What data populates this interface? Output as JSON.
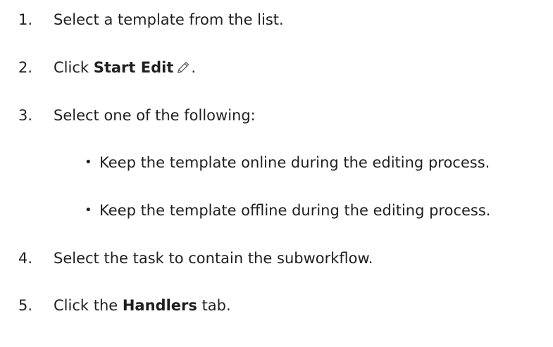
{
  "steps": [
    {
      "number": "1.",
      "text": "Select a template from the list."
    },
    {
      "number": "2.",
      "prefix": "Click ",
      "bold": "Start Edit",
      "suffix": ".",
      "icon": "pencil-icon"
    },
    {
      "number": "3.",
      "text": "Select one of the following:"
    },
    {
      "number": "4.",
      "text": "Select the task to contain the subworkflow."
    },
    {
      "number": "5.",
      "prefix": "Click the ",
      "bold": "Handlers",
      "suffix": " tab."
    }
  ],
  "options": [
    {
      "bullet": "•",
      "text": "Keep the template online during the editing process."
    },
    {
      "bullet": "•",
      "text": "Keep the template offline during the editing process."
    }
  ]
}
